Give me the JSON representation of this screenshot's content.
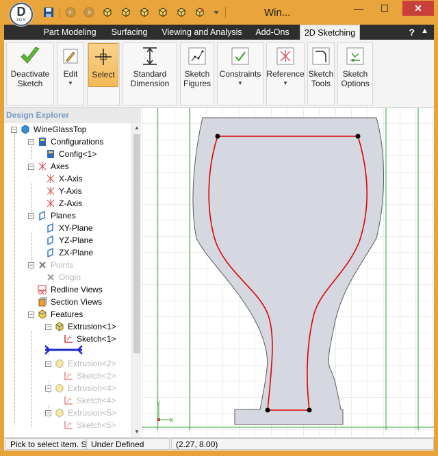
{
  "window": {
    "title": "Win...",
    "app_logo_letter": "D",
    "app_logo_sub": "3DS"
  },
  "quick_access": {
    "icons": [
      "save-icon",
      "undo-icon",
      "redo-icon",
      "cube-view-icon",
      "cube-view-icon",
      "cube-view-icon",
      "cube-view-icon",
      "cube-view-icon",
      "cube-view-icon",
      "customize-dropdown-icon"
    ]
  },
  "window_controls": {
    "minimize": "—",
    "maximize": "☐",
    "close": "✕"
  },
  "ribbon_tabs": [
    "Part Modeling",
    "Surfacing",
    "Viewing and Analysis",
    "Add-Ons",
    "2D Sketching"
  ],
  "active_tab": "2D Sketching",
  "ribbon_buttons": {
    "deactivate": {
      "line1": "Deactivate",
      "line2": "Sketch"
    },
    "edit": {
      "line1": "Edit"
    },
    "select": {
      "line1": "Select"
    },
    "standard_dimension": {
      "line1": "Standard",
      "line2": "Dimension"
    },
    "sketch_figures": {
      "line1": "Sketch",
      "line2": "Figures"
    },
    "constraints": {
      "line1": "Constraints"
    },
    "reference": {
      "line1": "Reference"
    },
    "sketch_tools": {
      "line1": "Sketch",
      "line2": "Tools"
    },
    "sketch_options": {
      "line1": "Sketch",
      "line2": "Options"
    }
  },
  "explorer": {
    "title": "Design Explorer",
    "nodes": [
      {
        "label": "WineGlassTop"
      },
      {
        "label": "Configurations"
      },
      {
        "label": "Config<1>"
      },
      {
        "label": "Axes"
      },
      {
        "label": "X-Axis"
      },
      {
        "label": "Y-Axis"
      },
      {
        "label": "Z-Axis"
      },
      {
        "label": "Planes"
      },
      {
        "label": "XY-Plane"
      },
      {
        "label": "YZ-Plane"
      },
      {
        "label": "ZX-Plane"
      },
      {
        "label": "Points"
      },
      {
        "label": "Origin"
      },
      {
        "label": "Redline Views"
      },
      {
        "label": "Section Views"
      },
      {
        "label": "Features"
      },
      {
        "label": "Extrusion<1>"
      },
      {
        "label": "Sketch<1>"
      },
      {
        "label": "Extrusion<2>"
      },
      {
        "label": "Sketch<2>"
      },
      {
        "label": "Extrusion<4>"
      },
      {
        "label": "Sketch<4>"
      },
      {
        "label": "Extrusion<5>"
      },
      {
        "label": "Sketch<5>"
      }
    ]
  },
  "viewport": {
    "glass_fill": "#d5d8e0",
    "sketch_color": "#e00000",
    "grid_color": "#d8d8d8",
    "axis_green": "#2ea02e",
    "axis_labels": {
      "x": "X",
      "y": "Y"
    }
  },
  "status_bar": {
    "message": "Pick to select item. Sh",
    "state": "Under Defined",
    "coordinates": "(2.27, 8.00)"
  }
}
